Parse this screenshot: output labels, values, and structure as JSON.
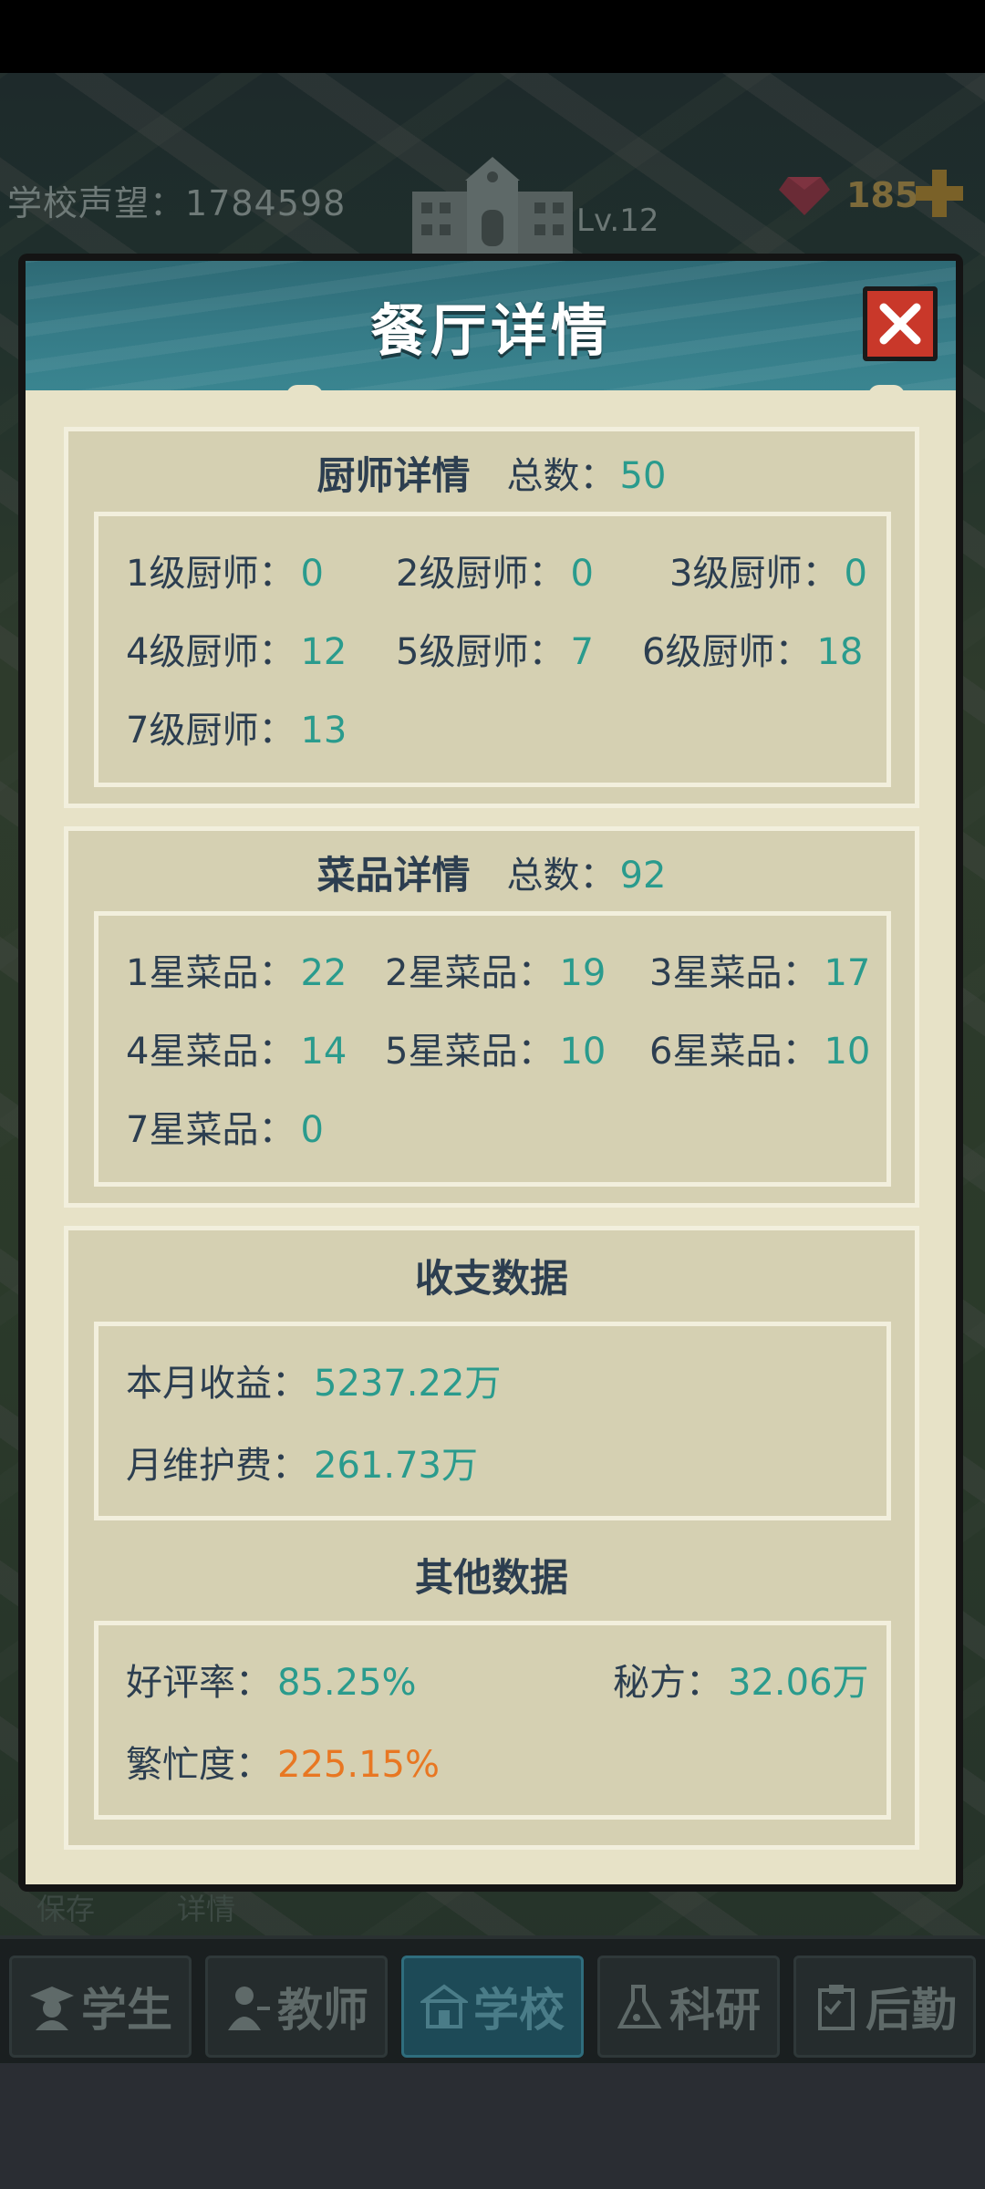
{
  "hud": {
    "reputation_label": "学校声望：",
    "reputation_value": "1784598",
    "level": "Lv.12",
    "gems": "185"
  },
  "modal": {
    "title": "餐厅详情",
    "chefs": {
      "heading": "厨师详情",
      "total_label": "总数：",
      "total": "50",
      "items": [
        {
          "label": "1级厨师：",
          "value": "0"
        },
        {
          "label": "2级厨师：",
          "value": "0"
        },
        {
          "label": "3级厨师：",
          "value": "0"
        },
        {
          "label": "4级厨师：",
          "value": "12"
        },
        {
          "label": "5级厨师：",
          "value": "7"
        },
        {
          "label": "6级厨师：",
          "value": "18"
        },
        {
          "label": "7级厨师：",
          "value": "13"
        }
      ]
    },
    "dishes": {
      "heading": "菜品详情",
      "total_label": "总数：",
      "total": "92",
      "items": [
        {
          "label": "1星菜品：",
          "value": "22"
        },
        {
          "label": "2星菜品：",
          "value": "19"
        },
        {
          "label": "3星菜品：",
          "value": "17"
        },
        {
          "label": "4星菜品：",
          "value": "14"
        },
        {
          "label": "5星菜品：",
          "value": "10"
        },
        {
          "label": "6星菜品：",
          "value": "10"
        },
        {
          "label": "7星菜品：",
          "value": "0"
        }
      ]
    },
    "finance": {
      "heading": "收支数据",
      "income_label": "本月收益：",
      "income": "5237.22万",
      "maintenance_label": "月维护费：",
      "maintenance": "261.73万"
    },
    "other": {
      "heading": "其他数据",
      "rating_label": "好评率：",
      "rating": "85.25%",
      "recipe_label": "秘方：",
      "recipe": "32.06万",
      "busy_label": "繁忙度：",
      "busy": "225.15%"
    }
  },
  "peek": {
    "left": "保存",
    "right": "详情"
  },
  "nav": [
    {
      "label": "学生",
      "icon": "student-icon"
    },
    {
      "label": "教师",
      "icon": "teacher-icon"
    },
    {
      "label": "学校",
      "icon": "school-icon"
    },
    {
      "label": "科研",
      "icon": "research-icon"
    },
    {
      "label": "后勤",
      "icon": "logistics-icon"
    }
  ],
  "colors": {
    "value_teal": "#2a9b8d",
    "value_orange": "#e87722",
    "heading": "#2c3e50",
    "close_red": "#c9382a",
    "header_teal": "#357a86"
  }
}
